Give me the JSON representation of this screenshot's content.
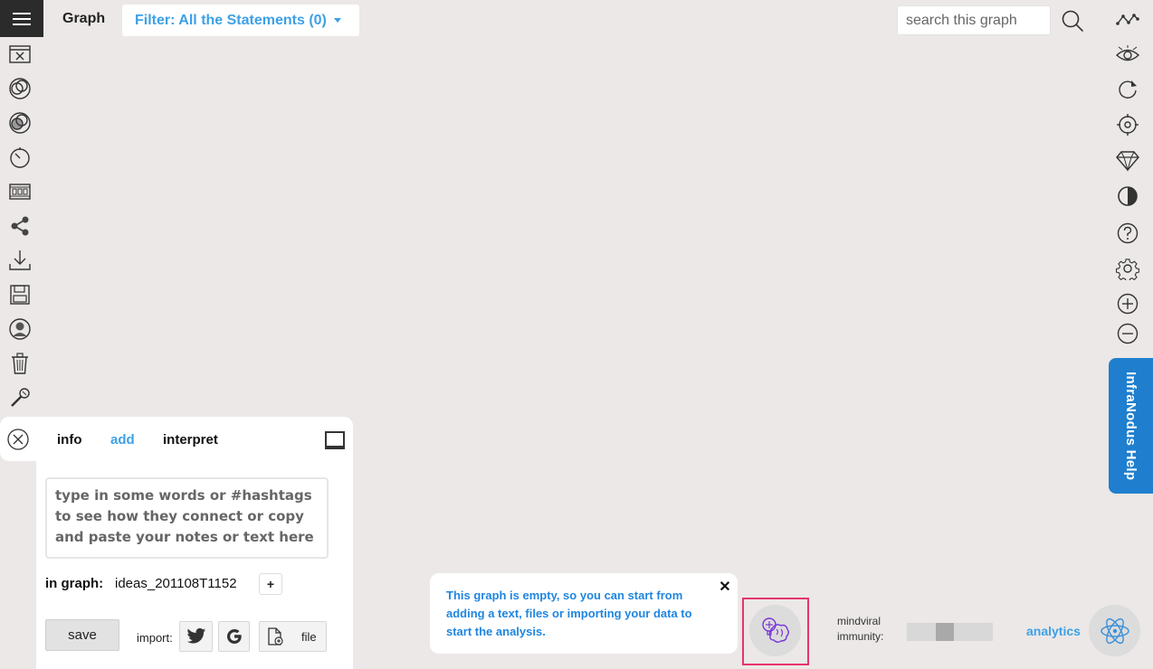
{
  "header": {
    "menu_icon": "hamburger-menu-icon",
    "title": "Graph",
    "filter_label": "Filter: All the Statements (0)",
    "search_placeholder": "search this graph",
    "search_icon": "magnifier-icon"
  },
  "left_toolbar": [
    {
      "name": "close-window-icon"
    },
    {
      "name": "overlap-circles-icon"
    },
    {
      "name": "compare-circles-icon"
    },
    {
      "name": "timer-icon"
    },
    {
      "name": "film-strip-icon"
    },
    {
      "name": "share-icon"
    },
    {
      "name": "download-icon"
    },
    {
      "name": "save-disk-icon"
    },
    {
      "name": "user-icon"
    },
    {
      "name": "trash-icon"
    },
    {
      "name": "microphone-icon"
    }
  ],
  "right_toolbar": [
    {
      "name": "graph-line-icon"
    },
    {
      "name": "eye-icon"
    },
    {
      "name": "refresh-icon"
    },
    {
      "name": "target-icon"
    },
    {
      "name": "diamond-icon"
    },
    {
      "name": "contrast-icon"
    },
    {
      "name": "help-icon"
    },
    {
      "name": "settings-gear-icon"
    },
    {
      "name": "zoom-in-icon"
    },
    {
      "name": "zoom-out-icon"
    }
  ],
  "help_tab": {
    "label": "InfraNodus Help"
  },
  "panel": {
    "tabs": [
      {
        "label": "info"
      },
      {
        "label": "add"
      },
      {
        "label": "interpret"
      }
    ],
    "active_tab": "add",
    "input_placeholder": "type in some words or #hashtags to see how they connect or copy and paste your notes or text here",
    "in_graph_label": "in graph:",
    "graph_name": "ideas_201108T1152",
    "add_context_label": "+",
    "save_label": "save",
    "import_label": "import:",
    "file_label": "file"
  },
  "notice": {
    "text": "This graph is empty, so you can start from adding a text, files or importing your data to start the analysis.",
    "close_label": "✕"
  },
  "mindviral": {
    "label_line1": "mindviral",
    "label_line2": "immunity:",
    "level": 0.42
  },
  "analytics": {
    "label": "analytics"
  },
  "colors": {
    "accent": "#3ea0e6",
    "help_tab": "#1f7fce",
    "highlight_frame": "#e8336e",
    "background": "#ebe8e7"
  }
}
